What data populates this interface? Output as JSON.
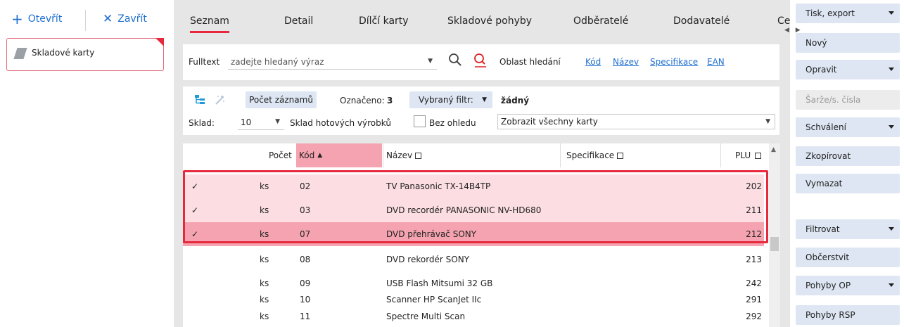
{
  "toolbar": {
    "open_label": "Otevřít",
    "close_label": "Zavřít",
    "open_icon": "+",
    "close_icon": "✕"
  },
  "card": {
    "label": "Skladové karty"
  },
  "tabs": [
    "Seznam",
    "Detail",
    "Dílčí karty",
    "Skladové pohyby",
    "Odběratelé",
    "Dodavatelé",
    "Cer"
  ],
  "search": {
    "label": "Fulltext",
    "placeholder": "zadejte hledaný výraz",
    "area_label": "Oblast hledání",
    "areas": [
      "Kód",
      "Název",
      "Specifikace",
      "EAN"
    ]
  },
  "filter": {
    "count_button": "Počet záznamů",
    "marked_label": "Označeno:",
    "marked_value": "3",
    "selected_filter_label": "Vybraný filtr:",
    "selected_filter_value": "žádný",
    "warehouse_label": "Sklad:",
    "warehouse_value": "10",
    "warehouse_name": "Sklad hotových výrobků",
    "checkbox_label": "Bez ohledu",
    "display_value": "Zobrazit všechny karty"
  },
  "table": {
    "columns": {
      "count": "Počet",
      "code": "Kód",
      "name": "Název",
      "spec": "Specifikace",
      "plu": "PLU"
    },
    "rows": [
      {
        "check": "✓",
        "unit": "ks",
        "code": "02",
        "name": "TV Panasonic TX-14B4TP",
        "plu": "202"
      },
      {
        "check": "✓",
        "unit": "ks",
        "code": "03",
        "name": "DVD recordér PANASONIC NV-HD680",
        "plu": "211"
      },
      {
        "check": "✓",
        "unit": "ks",
        "code": "07",
        "name": "DVD přehrávač SONY",
        "plu": "212"
      },
      {
        "check": "",
        "unit": "ks",
        "code": "08",
        "name": "DVD rekordér SONY",
        "plu": "213"
      },
      {
        "check": "",
        "unit": "ks",
        "code": "09",
        "name": "USB Flash Mitsumi 32 GB",
        "plu": "242"
      },
      {
        "check": "",
        "unit": "ks",
        "code": "10",
        "name": "Scanner HP ScanJet IIc",
        "plu": "291"
      },
      {
        "check": "",
        "unit": "ks",
        "code": "11",
        "name": "Spectre Multi Scan",
        "plu": "292"
      }
    ]
  },
  "actions": [
    {
      "label": "Tisk, export",
      "dropdown": true
    },
    {
      "label": "Nový",
      "dropdown": false
    },
    {
      "label": "Opravit",
      "dropdown": true
    },
    {
      "label": "Šarže/s. čísla",
      "dropdown": false,
      "disabled": true
    },
    {
      "label": "Schválení",
      "dropdown": true
    },
    {
      "label": "Zkopírovat",
      "dropdown": false
    },
    {
      "label": "Vymazat",
      "dropdown": false
    },
    {
      "label": "Filtrovat",
      "dropdown": true
    },
    {
      "label": "Občerstvit",
      "dropdown": false
    },
    {
      "label": "Pohyby OP",
      "dropdown": true
    },
    {
      "label": "Pohyby RSP",
      "dropdown": false
    }
  ],
  "colors": {
    "accent": "#e8293d",
    "link": "#1f6fd0",
    "selected_row": "#fbdde2",
    "selected_row_active": "#f5a3b0",
    "button": "#dde6f2"
  }
}
